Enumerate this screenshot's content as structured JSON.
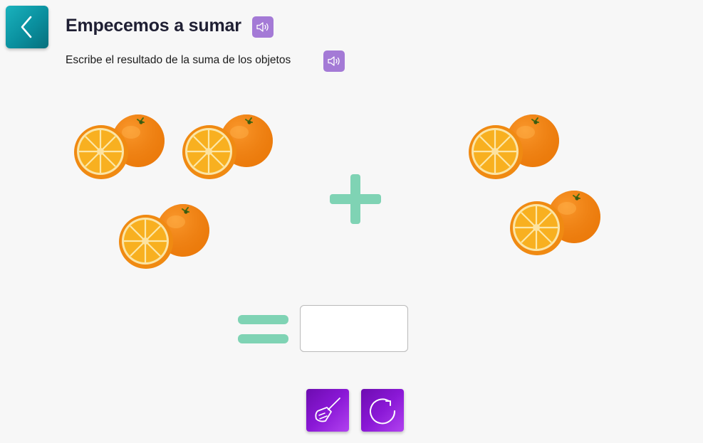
{
  "header": {
    "title": "Empecemos a sumar",
    "instruction": "Escribe el resultado de la suma de los objetos"
  },
  "icons": {
    "back": "chevron-left-icon",
    "audio": "speaker-icon",
    "clear": "broom-icon",
    "reset": "redo-icon",
    "operator_plus": "plus-sign",
    "operator_equals": "equals-sign"
  },
  "exercise": {
    "object": "orange",
    "left_group_count": 3,
    "right_group_count": 2,
    "answer_value": ""
  },
  "colors": {
    "back_button": "#0a8f9e",
    "audio_button": "#a47ad6",
    "tool_button": "#8a18d6",
    "operator": "#7fd3b4",
    "orange_peel": "#f28a10",
    "orange_flesh": "#f9b322"
  }
}
